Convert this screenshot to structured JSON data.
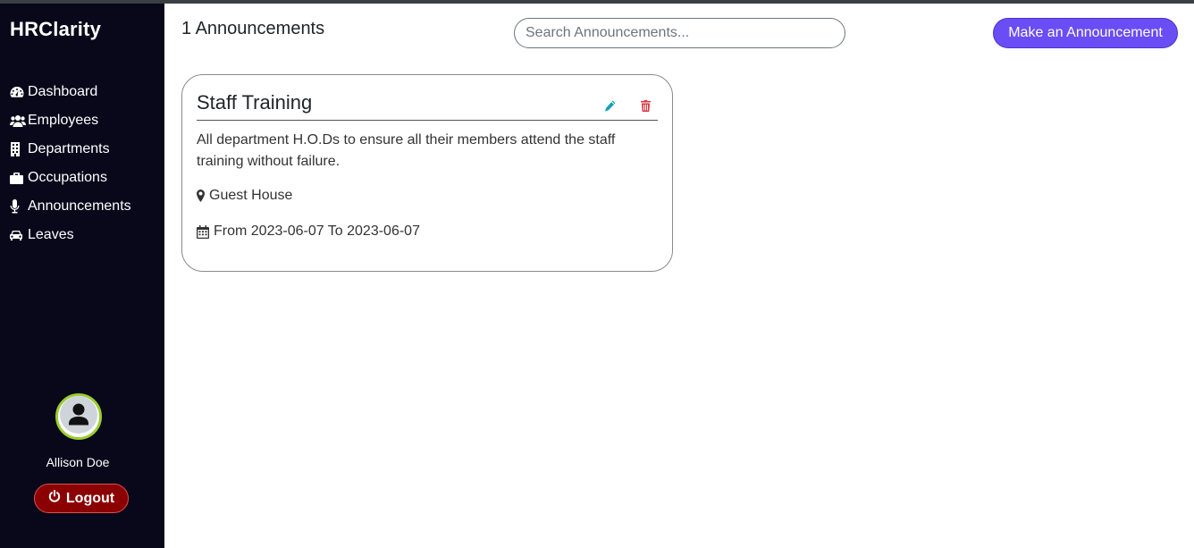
{
  "app": {
    "brand": "HRClarity"
  },
  "sidebar": {
    "items": [
      {
        "label": "Dashboard",
        "icon": "dashboard-icon"
      },
      {
        "label": "Employees",
        "icon": "users-icon"
      },
      {
        "label": "Departments",
        "icon": "building-icon"
      },
      {
        "label": "Occupations",
        "icon": "briefcase-icon"
      },
      {
        "label": "Announcements",
        "icon": "microphone-icon"
      },
      {
        "label": "Leaves",
        "icon": "car-icon"
      }
    ],
    "user": {
      "name": "Allison Doe"
    },
    "logout_label": "Logout"
  },
  "header": {
    "title": "1 Announcements",
    "search_placeholder": "Search Announcements...",
    "search_value": "",
    "make_button_label": "Make an Announcement"
  },
  "announcements": [
    {
      "title": "Staff Training",
      "body": "All department H.O.Ds to ensure all their members attend the staff training without failure.",
      "location": "Guest House",
      "dates": "From 2023-06-07 To 2023-06-07"
    }
  ],
  "colors": {
    "sidebar_bg": "#09071a",
    "accent": "#6a4df4",
    "logout_bg": "#8b0000",
    "edit_icon": "#17a2b8",
    "delete_icon": "#dc3545",
    "avatar_ring": "#9acd32"
  }
}
